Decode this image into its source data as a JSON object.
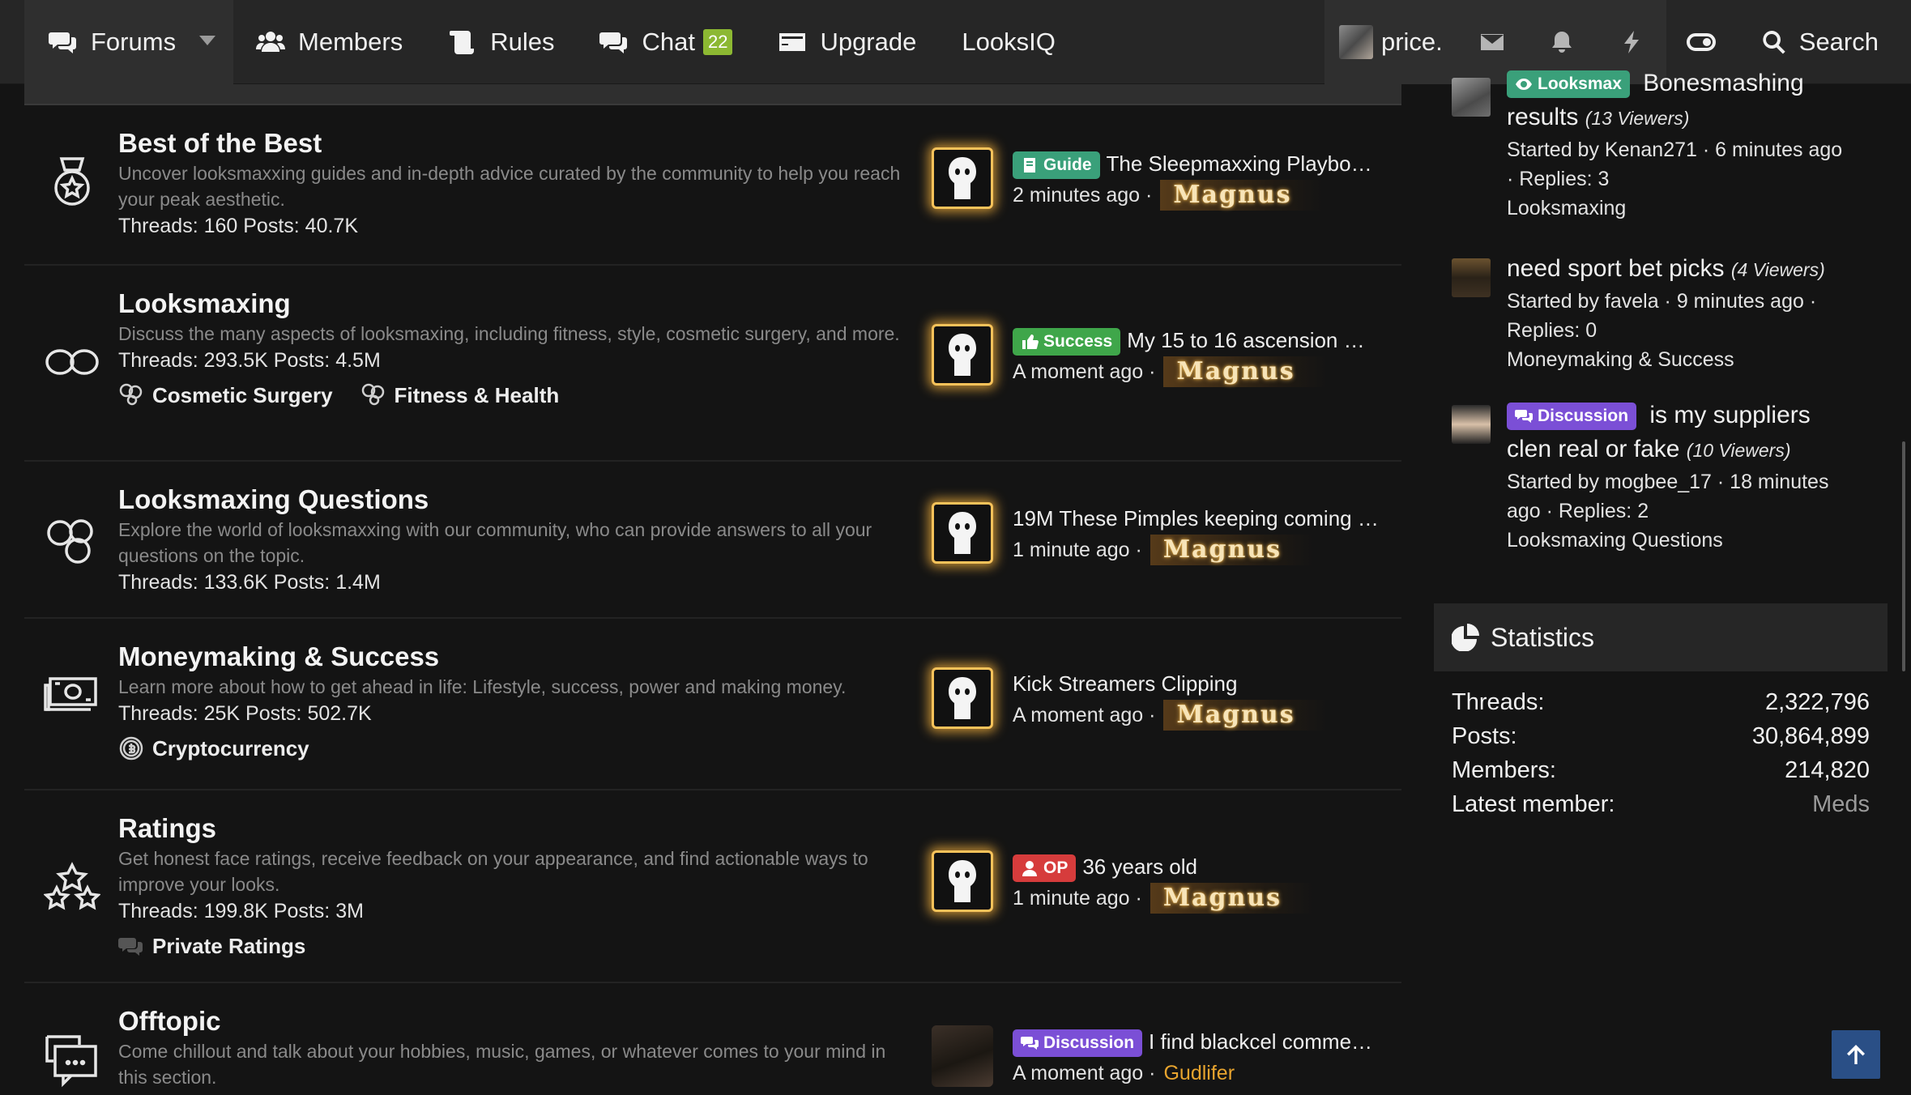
{
  "nav": {
    "forums": "Forums",
    "members": "Members",
    "rules": "Rules",
    "chat": "Chat",
    "chat_badge": "22",
    "upgrade": "Upgrade",
    "looksiq": "LooksIQ",
    "username": "price.",
    "search": "Search"
  },
  "nodes": [
    {
      "title": "Best of the Best",
      "desc": "Uncover looksmaxxing guides and in-depth advice curated by the community to help you reach your peak aesthetic.",
      "stats": "Threads: 160 Posts: 40.7K",
      "last": {
        "prefix": "Guide",
        "title": "The Sleepmaxxing Playbo…",
        "time": "2 minutes ago ·",
        "user": "Magnus"
      }
    },
    {
      "title": "Looksmaxing",
      "desc": "Discuss the many aspects of looksmaxing, including fitness, style, cosmetic surgery, and more.",
      "stats": "Threads: 293.5K Posts: 4.5M",
      "subforums": [
        "Cosmetic Surgery",
        "Fitness & Health"
      ],
      "last": {
        "prefix": "Success",
        "title": "My 15 to 16 ascension …",
        "time": "A moment ago ·",
        "user": "Magnus"
      }
    },
    {
      "title": "Looksmaxing Questions",
      "desc": "Explore the world of looksmaxxing with our community, who can provide answers to all your questions on the topic.",
      "stats": "Threads: 133.6K Posts: 1.4M",
      "last": {
        "title": "19M These Pimples keeping coming …",
        "time": "1 minute ago ·",
        "user": "Magnus"
      }
    },
    {
      "title": "Moneymaking & Success",
      "desc": "Learn more about how to get ahead in life: Lifestyle, success, power and making money.",
      "stats": "Threads: 25K Posts: 502.7K",
      "subforums": [
        "Cryptocurrency"
      ],
      "last": {
        "title": "Kick Streamers Clipping",
        "time": "A moment ago ·",
        "user": "Magnus"
      }
    },
    {
      "title": "Ratings",
      "desc": "Get honest face ratings, receive feedback on your appearance, and find actionable ways to improve your looks.",
      "stats": "Threads: 199.8K Posts: 3M",
      "subforums": [
        "Private Ratings"
      ],
      "last": {
        "prefix": "OP",
        "title": "36 years old",
        "time": "1 minute ago ·",
        "user": "Magnus"
      }
    },
    {
      "title": "Offtopic",
      "desc": "Come chillout and talk about your hobbies, music, games, or whatever comes to your mind in this section.",
      "last": {
        "prefix": "Discussion",
        "title": "I find blackcel comme…",
        "time": "A moment ago ·",
        "user": "Gudlifer"
      }
    }
  ],
  "sidebar": {
    "threads": [
      {
        "prefix": "Looksmax",
        "title": "Bonesmashing results",
        "title_line2": "results",
        "viewers": "(13 Viewers)",
        "meta1": "Started by Kenan271 · 6 minutes ago",
        "meta2": "· Replies: 3",
        "forum": "Looksmaxing"
      },
      {
        "title": "need sport bet picks",
        "viewers": "(4 Viewers)",
        "meta1": "Started by favela · 9 minutes ago ·",
        "meta2": "Replies: 0",
        "forum": "Moneymaking & Success"
      },
      {
        "prefix": "Discussion",
        "title": "is my suppliers",
        "title_line2": "clen real or fake",
        "viewers": "(10 Viewers)",
        "meta1": "Started by mogbee_17 · 18 minutes",
        "meta2": "ago · Replies: 2",
        "forum": "Looksmaxing Questions"
      }
    ],
    "statistics": {
      "title": "Statistics",
      "rows": [
        {
          "label": "Threads:",
          "value": "2,322,796"
        },
        {
          "label": "Posts:",
          "value": "30,864,899"
        },
        {
          "label": "Members:",
          "value": "214,820"
        },
        {
          "label": "Latest member:",
          "value": "Meds"
        }
      ]
    }
  },
  "colors": {
    "background": "#141414",
    "nav": "#262626",
    "chat_badge": "#8cb832",
    "guide": "#3aa07a",
    "success": "#3fa64a",
    "op": "#d63c3c",
    "discussion": "#7b4fd6",
    "gold": "#f6c25a",
    "back_to_top": "#2a4f86"
  }
}
